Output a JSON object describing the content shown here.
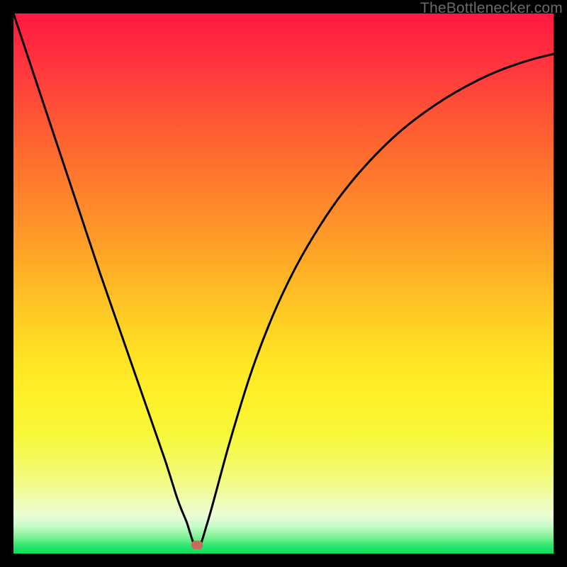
{
  "watermark": "TheBottlenecker.com",
  "marker": {
    "x_frac": 0.34,
    "y_frac": 0.984
  },
  "chart_data": {
    "type": "line",
    "title": "",
    "xlabel": "",
    "ylabel": "",
    "xlim": [
      0,
      1
    ],
    "ylim": [
      0,
      1
    ],
    "series": [
      {
        "name": "bottleneck-curve",
        "x": [
          0.0,
          0.04,
          0.08,
          0.12,
          0.16,
          0.2,
          0.24,
          0.28,
          0.304,
          0.32,
          0.34,
          0.36,
          0.4,
          0.44,
          0.48,
          0.52,
          0.56,
          0.6,
          0.64,
          0.68,
          0.72,
          0.76,
          0.8,
          0.84,
          0.88,
          0.92,
          0.96,
          1.0
        ],
        "y": [
          1.0,
          0.88,
          0.76,
          0.64,
          0.52,
          0.405,
          0.29,
          0.175,
          0.1,
          0.06,
          0.01,
          0.06,
          0.205,
          0.335,
          0.44,
          0.525,
          0.595,
          0.655,
          0.705,
          0.748,
          0.785,
          0.816,
          0.843,
          0.866,
          0.886,
          0.902,
          0.915,
          0.925
        ]
      }
    ],
    "gradient_stops": [
      {
        "pos": 0.0,
        "color": "#ff1842"
      },
      {
        "pos": 0.3,
        "color": "#ff782d"
      },
      {
        "pos": 0.6,
        "color": "#ffd824"
      },
      {
        "pos": 0.8,
        "color": "#f6f848"
      },
      {
        "pos": 0.93,
        "color": "#ecfdd5"
      },
      {
        "pos": 1.0,
        "color": "#06df5c"
      }
    ],
    "marker": {
      "x": 0.34,
      "y": 0.016
    }
  }
}
